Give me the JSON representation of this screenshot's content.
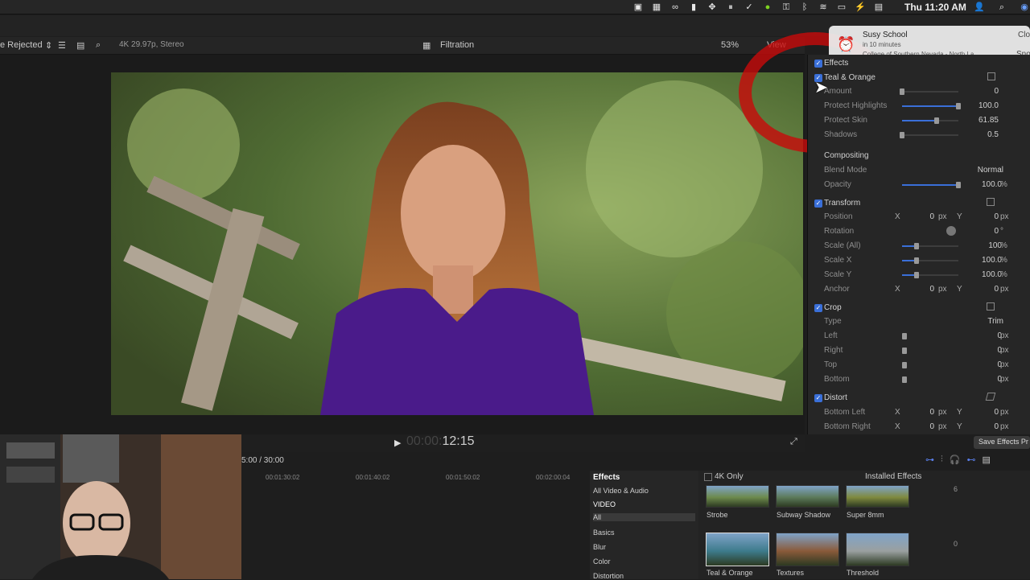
{
  "menubar": {
    "clock": "Thu 11:20 AM"
  },
  "subtoolbar": {
    "library_filter": "e Rejected",
    "format_info": "4K 29.97p, Stereo",
    "viewer_title": "Filtration",
    "zoom": "53%",
    "view_menu": "View"
  },
  "notification": {
    "title": "Susy School",
    "time": "in 10 minutes",
    "location": "College of Southern Nevada - North La...",
    "close": "Clo",
    "snooze": "Sno"
  },
  "timecode": {
    "dim": "00:00:",
    "main": "12:15"
  },
  "inspector": {
    "effects_header": "Effects",
    "teal_orange": {
      "title": "Teal & Orange",
      "amount_label": "Amount",
      "amount_value": "0",
      "amount_level": 0,
      "highlights_label": "Protect Highlights",
      "highlights_value": "100.0",
      "highlights_level": 1.0,
      "skin_label": "Protect Skin",
      "skin_value": "61.85",
      "skin_level": 0.6185,
      "shadows_label": "Shadows",
      "shadows_value": "0.5",
      "shadows_level": 0.0
    },
    "compositing": {
      "title": "Compositing",
      "blend_label": "Blend Mode",
      "blend_value": "Normal",
      "opacity_label": "Opacity",
      "opacity_value": "100.0",
      "opacity_unit": "%",
      "opacity_level": 1.0
    },
    "transform": {
      "title": "Transform",
      "position_label": "Position",
      "position_x": "0",
      "position_y": "0",
      "rotation_label": "Rotation",
      "rotation_value": "0",
      "rotation_unit": "°",
      "scale_all_label": "Scale (All)",
      "scale_all_value": "100",
      "scale_all_level": 0.25,
      "scale_x_label": "Scale X",
      "scale_x_value": "100.0",
      "scale_x_level": 0.25,
      "scale_y_label": "Scale Y",
      "scale_y_value": "100.0",
      "scale_y_level": 0.25,
      "anchor_label": "Anchor",
      "anchor_x": "0",
      "anchor_y": "0",
      "unit_px": "px",
      "unit_pct": "%",
      "x_label": "X",
      "y_label": "Y"
    },
    "crop": {
      "title": "Crop",
      "type_label": "Type",
      "type_value": "Trim",
      "left_label": "Left",
      "left_value": "0",
      "right_label": "Right",
      "right_value": "0",
      "top_label": "Top",
      "top_value": "0",
      "bottom_label": "Bottom",
      "bottom_value": "0"
    },
    "distort": {
      "title": "Distort",
      "bl_label": "Bottom Left",
      "bl_x": "0",
      "bl_y": "0",
      "br_label": "Bottom Right",
      "br_x": "0",
      "br_y": "0"
    },
    "save_button": "Save Effects Pr"
  },
  "timeline": {
    "duration": "5:00 / 30:00",
    "ruler": [
      "00:01:30:02",
      "00:01:40:02",
      "00:01:50:02",
      "00:02:00:04"
    ]
  },
  "effects_browser": {
    "header": "Effects",
    "categories": [
      "All Video & Audio",
      "VIDEO",
      "All",
      "Basics",
      "Blur",
      "Color",
      "Distortion"
    ],
    "filter_4k": "4K Only",
    "installed": "Installed Effects",
    "thumbs": [
      {
        "label": "Strobe",
        "color": "#6d8a4c"
      },
      {
        "label": "Subway Shadow",
        "color": "#5c7a5a"
      },
      {
        "label": "Super 8mm",
        "color": "#7f8a3e"
      },
      {
        "label": "Teal & Orange",
        "color": "#3d7b8c"
      },
      {
        "label": "Textures",
        "color": "#8a5a3a"
      },
      {
        "label": "Threshold",
        "color": "#9aa0a0"
      }
    ],
    "meter_top": "6",
    "meter_bottom": "0"
  }
}
